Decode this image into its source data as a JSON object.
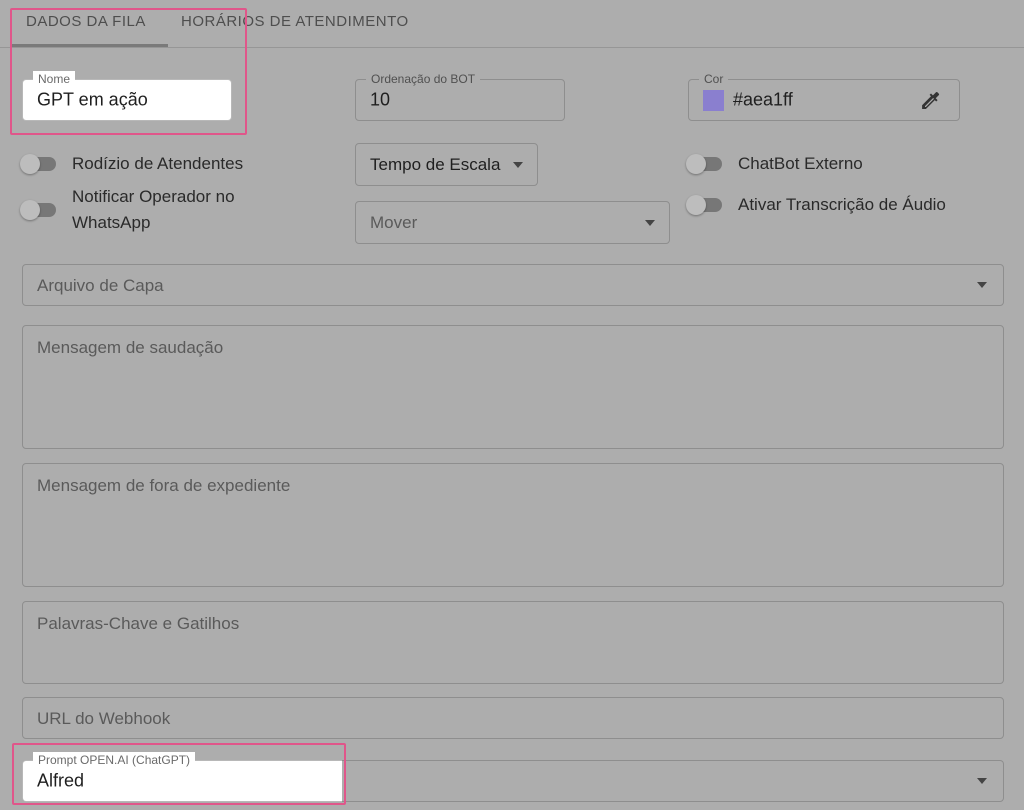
{
  "tabs": [
    {
      "label": "Dados da Fila",
      "active": true
    },
    {
      "label": "Horários de Atendimento",
      "active": false
    }
  ],
  "fields": {
    "nome": {
      "label": "Nome",
      "value": "GPT em ação"
    },
    "ordenacao": {
      "label": "Ordenação do BOT",
      "value": "10"
    },
    "cor": {
      "label": "Cor",
      "value": "#aea1ff",
      "swatch_color": "#8a7fcf"
    },
    "tempo_escala": {
      "value": "Tempo de Escala"
    },
    "mover": {
      "placeholder": "Mover"
    },
    "arquivo_capa": {
      "placeholder": "Arquivo de Capa"
    },
    "mensagem_saudacao": {
      "placeholder": "Mensagem de saudação"
    },
    "mensagem_fora": {
      "placeholder": "Mensagem de fora de expediente"
    },
    "palavras_chave": {
      "placeholder": "Palavras-Chave e Gatilhos"
    },
    "url_webhook": {
      "placeholder": "URL do Webhook"
    },
    "prompt": {
      "label": "Prompt OPEN.AI (ChatGPT)",
      "value": "Alfred"
    }
  },
  "switches": {
    "rodizio": {
      "label": "Rodízio de Atendentes",
      "on": false
    },
    "notificar_line1": "Notificar Operador no",
    "notificar_line2": "WhatsApp",
    "chatbot_externo": {
      "label": "ChatBot Externo",
      "on": false
    },
    "transcricao": {
      "label": "Ativar Transcrição de Áudio",
      "on": false
    }
  },
  "icons": {
    "picker": "eyedropper-icon",
    "dropdown": "caret-down-icon"
  },
  "colors": {
    "highlight": "#e0568a",
    "overlay": "#adadad"
  }
}
